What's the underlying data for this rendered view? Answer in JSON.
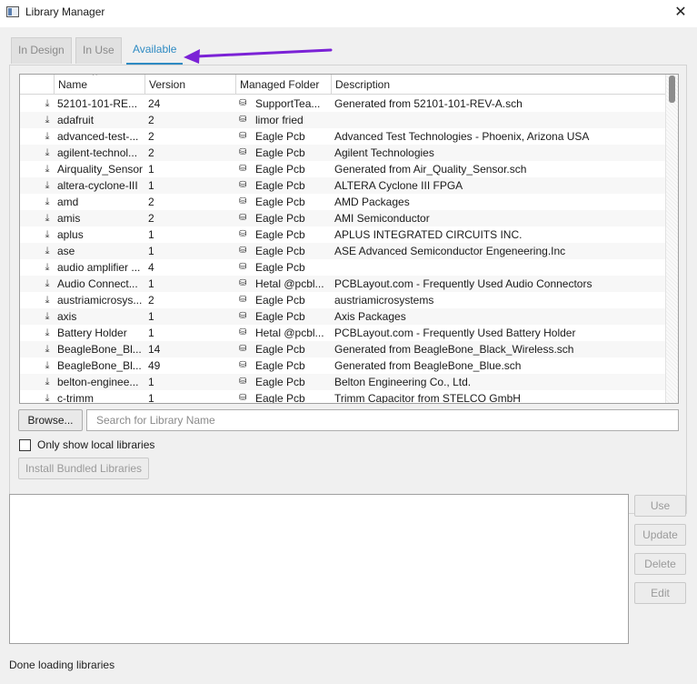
{
  "window": {
    "title": "Library Manager"
  },
  "tabs": [
    {
      "label": "In Design",
      "active": false
    },
    {
      "label": "In Use",
      "active": false
    },
    {
      "label": "Available",
      "active": true
    }
  ],
  "table": {
    "columns": [
      "Name",
      "Version",
      "Managed Folder",
      "Description"
    ],
    "rows": [
      {
        "name": "52101-101-RE...",
        "version": "24",
        "folder": "SupportTea...",
        "description": "Generated from 52101-101-REV-A.sch"
      },
      {
        "name": "adafruit",
        "version": "2",
        "folder": "limor fried",
        "description": ""
      },
      {
        "name": "advanced-test-...",
        "version": "2",
        "folder": "Eagle Pcb",
        "description": "Advanced Test Technologies - Phoenix, Arizona USA"
      },
      {
        "name": "agilent-technol...",
        "version": "2",
        "folder": "Eagle Pcb",
        "description": "Agilent Technologies"
      },
      {
        "name": "Airquality_Sensor",
        "version": "1",
        "folder": "Eagle Pcb",
        "description": "Generated from Air_Quality_Sensor.sch"
      },
      {
        "name": "altera-cyclone-III",
        "version": "1",
        "folder": "Eagle Pcb",
        "description": "ALTERA Cyclone III FPGA"
      },
      {
        "name": "amd",
        "version": "2",
        "folder": "Eagle Pcb",
        "description": "AMD Packages"
      },
      {
        "name": "amis",
        "version": "2",
        "folder": "Eagle Pcb",
        "description": "AMI Semiconductor"
      },
      {
        "name": "aplus",
        "version": "1",
        "folder": "Eagle Pcb",
        "description": "APLUS INTEGRATED CIRCUITS INC."
      },
      {
        "name": "ase",
        "version": "1",
        "folder": "Eagle Pcb",
        "description": "ASE Advanced Semiconductor Engeneering.Inc"
      },
      {
        "name": "audio amplifier ...",
        "version": "4",
        "folder": "Eagle Pcb",
        "description": ""
      },
      {
        "name": "Audio Connect...",
        "version": "1",
        "folder": "Hetal @pcbl...",
        "description": "PCBLayout.com - Frequently Used Audio Connectors"
      },
      {
        "name": "austriamicrosys...",
        "version": "2",
        "folder": "Eagle Pcb",
        "description": "austriamicrosystems"
      },
      {
        "name": "axis",
        "version": "1",
        "folder": "Eagle Pcb",
        "description": "Axis Packages"
      },
      {
        "name": "Battery Holder",
        "version": "1",
        "folder": "Hetal @pcbl...",
        "description": "PCBLayout.com - Frequently Used Battery Holder"
      },
      {
        "name": "BeagleBone_Bl...",
        "version": "14",
        "folder": "Eagle Pcb",
        "description": "Generated from BeagleBone_Black_Wireless.sch"
      },
      {
        "name": "BeagleBone_Bl...",
        "version": "49",
        "folder": "Eagle Pcb",
        "description": "Generated from BeagleBone_Blue.sch"
      },
      {
        "name": "belton-enginee...",
        "version": "1",
        "folder": "Eagle Pcb",
        "description": "Belton Engineering Co., Ltd."
      },
      {
        "name": "c-trimm",
        "version": "1",
        "folder": "Eagle Pcb",
        "description": "Trimm Capacitor from STELCO GmbH"
      }
    ]
  },
  "controls": {
    "browse_label": "Browse...",
    "search_placeholder": "Search for Library Name",
    "only_local_label": "Only show local libraries",
    "install_bundled_label": "Install Bundled Libraries"
  },
  "actions": {
    "use": "Use",
    "update": "Update",
    "delete": "Delete",
    "edit": "Edit"
  },
  "status": {
    "text": "Done loading libraries"
  },
  "colors": {
    "accent": "#2f8bc3",
    "annotation_arrow": "#7b22d6"
  }
}
